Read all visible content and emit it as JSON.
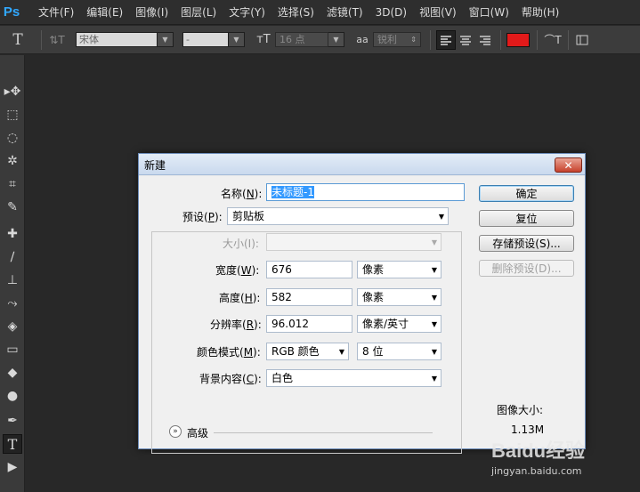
{
  "app": {
    "logo": "Ps"
  },
  "menu": [
    "文件(F)",
    "编辑(E)",
    "图像(I)",
    "图层(L)",
    "文字(Y)",
    "选择(S)",
    "滤镜(T)",
    "3D(D)",
    "视图(V)",
    "窗口(W)",
    "帮助(H)"
  ],
  "options": {
    "tool_glyph": "T",
    "orient_glyph": "⇅T",
    "font_family": "宋体",
    "font_style": "-",
    "size_glyph": "тT",
    "font_size": "16 点",
    "aa_glyph": "aa",
    "antialias": "锐利",
    "text_color": "#e21a1a",
    "warp_glyph": "⌒T"
  },
  "tools": [
    "move-tool",
    "marquee-tool",
    "lasso-tool",
    "magic-wand-tool",
    "crop-tool",
    "eyedropper-tool",
    "healing-brush-tool",
    "brush-tool",
    "clone-stamp-tool",
    "history-brush-tool",
    "eraser-tool",
    "gradient-tool",
    "blur-tool",
    "dodge-tool",
    "pen-tool",
    "type-tool",
    "path-selection-tool"
  ],
  "tool_glyphs": [
    "▸✥",
    "⬚",
    "◌",
    "✲",
    "⌗",
    "✎",
    "✚",
    "∕",
    "⊥",
    "⤳",
    "◈",
    "▭",
    "◆",
    "●",
    "✒",
    "T",
    "▶"
  ],
  "dialog": {
    "title": "新建",
    "close": "✕",
    "name_label_pre": "名称(",
    "name_label_key": "N",
    "name_label_post": "):",
    "name_value": "未标题-1",
    "preset_label_pre": "预设(",
    "preset_label_key": "P",
    "preset_label_post": "):",
    "preset_value": "剪贴板",
    "size_label": "大小(I):",
    "width_label_pre": "宽度(",
    "width_label_key": "W",
    "width_label_post": "):",
    "width_value": "676",
    "width_unit": "像素",
    "height_label_pre": "高度(",
    "height_label_key": "H",
    "height_label_post": "):",
    "height_value": "582",
    "height_unit": "像素",
    "resolution_label_pre": "分辨率(",
    "resolution_label_key": "R",
    "resolution_label_post": "):",
    "resolution_value": "96.012",
    "resolution_unit": "像素/英寸",
    "color_mode_label_pre": "颜色模式(",
    "color_mode_label_key": "M",
    "color_mode_label_post": "):",
    "color_mode_value": "RGB 颜色",
    "bit_depth": "8 位",
    "background_label_pre": "背景内容(",
    "background_label_key": "C",
    "background_label_post": "):",
    "background_value": "白色",
    "advanced_label": "高级",
    "buttons": {
      "ok": "确定",
      "reset": "复位",
      "save_preset": "存储预设(S)...",
      "delete_preset": "删除预设(D)..."
    },
    "image_size_label": "图像大小:",
    "image_size_value": "1.13M"
  },
  "watermark": {
    "logo": "Baidu经验",
    "url": "jingyan.baidu.com"
  }
}
